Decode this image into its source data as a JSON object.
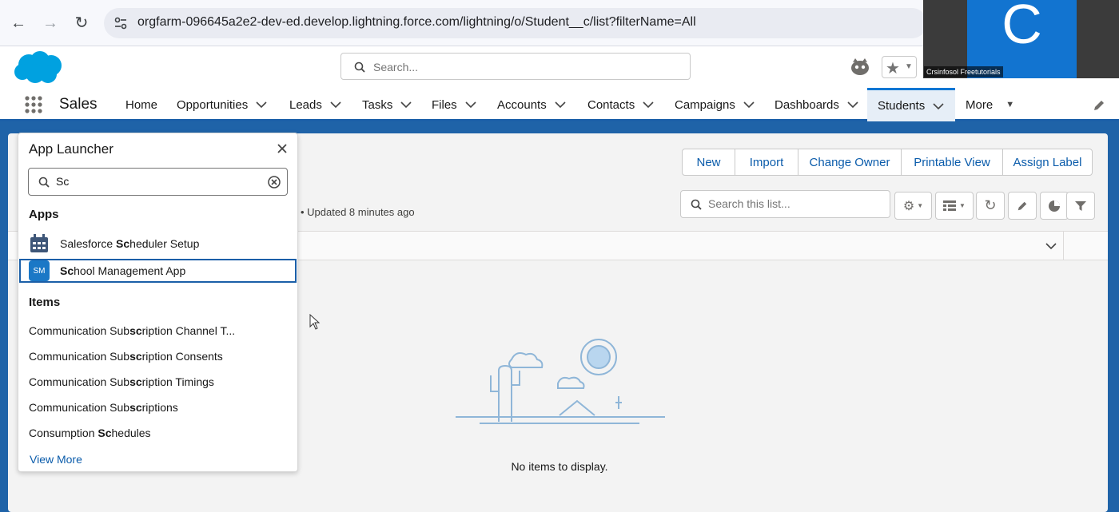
{
  "browser": {
    "url": "orgfarm-096645a2e2-dev-ed.develop.lightning.force.com/lightning/o/Student__c/list?filterName=All"
  },
  "webcam": {
    "letter": "C",
    "name": "Crsinfosol Freetutorials"
  },
  "header": {
    "search_placeholder": "Search..."
  },
  "nav": {
    "app_name": "Sales",
    "items": [
      {
        "label": "Home"
      },
      {
        "label": "Opportunities"
      },
      {
        "label": "Leads"
      },
      {
        "label": "Tasks"
      },
      {
        "label": "Files"
      },
      {
        "label": "Accounts"
      },
      {
        "label": "Contacts"
      },
      {
        "label": "Campaigns"
      },
      {
        "label": "Dashboards"
      },
      {
        "label": "Students"
      },
      {
        "label": "More"
      }
    ],
    "active": "Students"
  },
  "list_view": {
    "buttons": [
      "New",
      "Import",
      "Change Owner",
      "Printable View",
      "Assign Label"
    ],
    "search_placeholder": "Search this list...",
    "updated_text": "• Updated 8 minutes ago",
    "empty_text": "No items to display."
  },
  "launcher": {
    "title": "App Launcher",
    "search_value": "Sc",
    "apps_heading": "Apps",
    "apps": [
      {
        "pre": "Salesforce ",
        "match": "Sc",
        "post": "heduler Setup"
      },
      {
        "pre": "",
        "match": "Sc",
        "post": "hool Management App",
        "badge": "SM"
      }
    ],
    "items_heading": "Items",
    "items": [
      {
        "pre": "Communication Sub",
        "match": "sc",
        "post": "ription Channel T..."
      },
      {
        "pre": "Communication Sub",
        "match": "sc",
        "post": "ription Consents"
      },
      {
        "pre": "Communication Sub",
        "match": "sc",
        "post": "ription Timings"
      },
      {
        "pre": "Communication Sub",
        "match": "sc",
        "post": "riptions"
      },
      {
        "pre": "Consumption ",
        "match": "Sc",
        "post": "hedules"
      }
    ],
    "view_more": "View More"
  },
  "colors": {
    "brand": "#0176d3",
    "nav_underline": "#1b5fa8",
    "link": "#0b5cab"
  }
}
